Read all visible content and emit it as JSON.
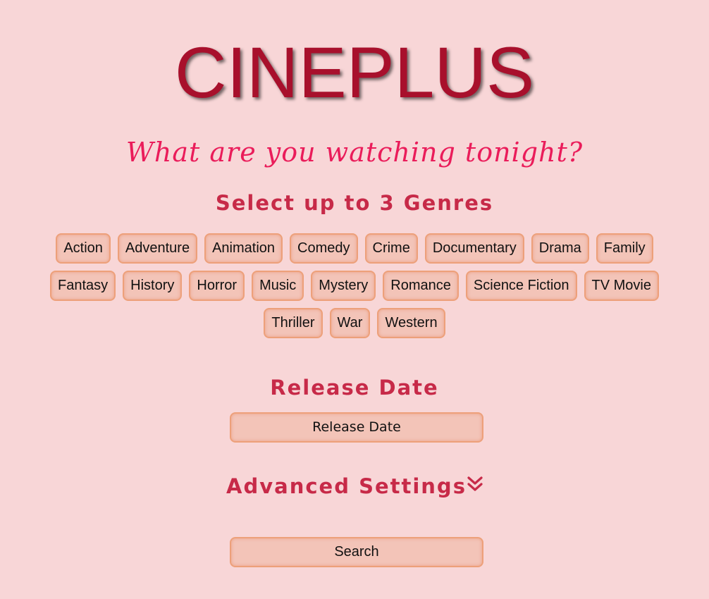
{
  "header": {
    "logo": "CINEPLUS",
    "tagline": "What are you watching tonight?"
  },
  "genres": {
    "title": "Select up to 3 Genres",
    "rows": [
      [
        "Action",
        "Adventure",
        "Animation",
        "Comedy",
        "Crime",
        "Documentary",
        "Drama",
        "Family"
      ],
      [
        "Fantasy",
        "History",
        "Horror",
        "Music",
        "Mystery",
        "Romance",
        "Science Fiction",
        "TV Movie"
      ],
      [
        "Thriller",
        "War",
        "Western"
      ]
    ]
  },
  "release": {
    "title": "Release Date",
    "button_label": "Release Date"
  },
  "advanced": {
    "title": "Advanced Settings",
    "icon": "double-chevron-down-icon"
  },
  "search": {
    "button_label": "Search"
  },
  "colors": {
    "background": "#f8d6d7",
    "logo": "#a8102c",
    "tagline": "#ea1c5a",
    "heading": "#c72a48",
    "chip_fill": "#f3c4b8",
    "chip_border": "#eda07a"
  }
}
